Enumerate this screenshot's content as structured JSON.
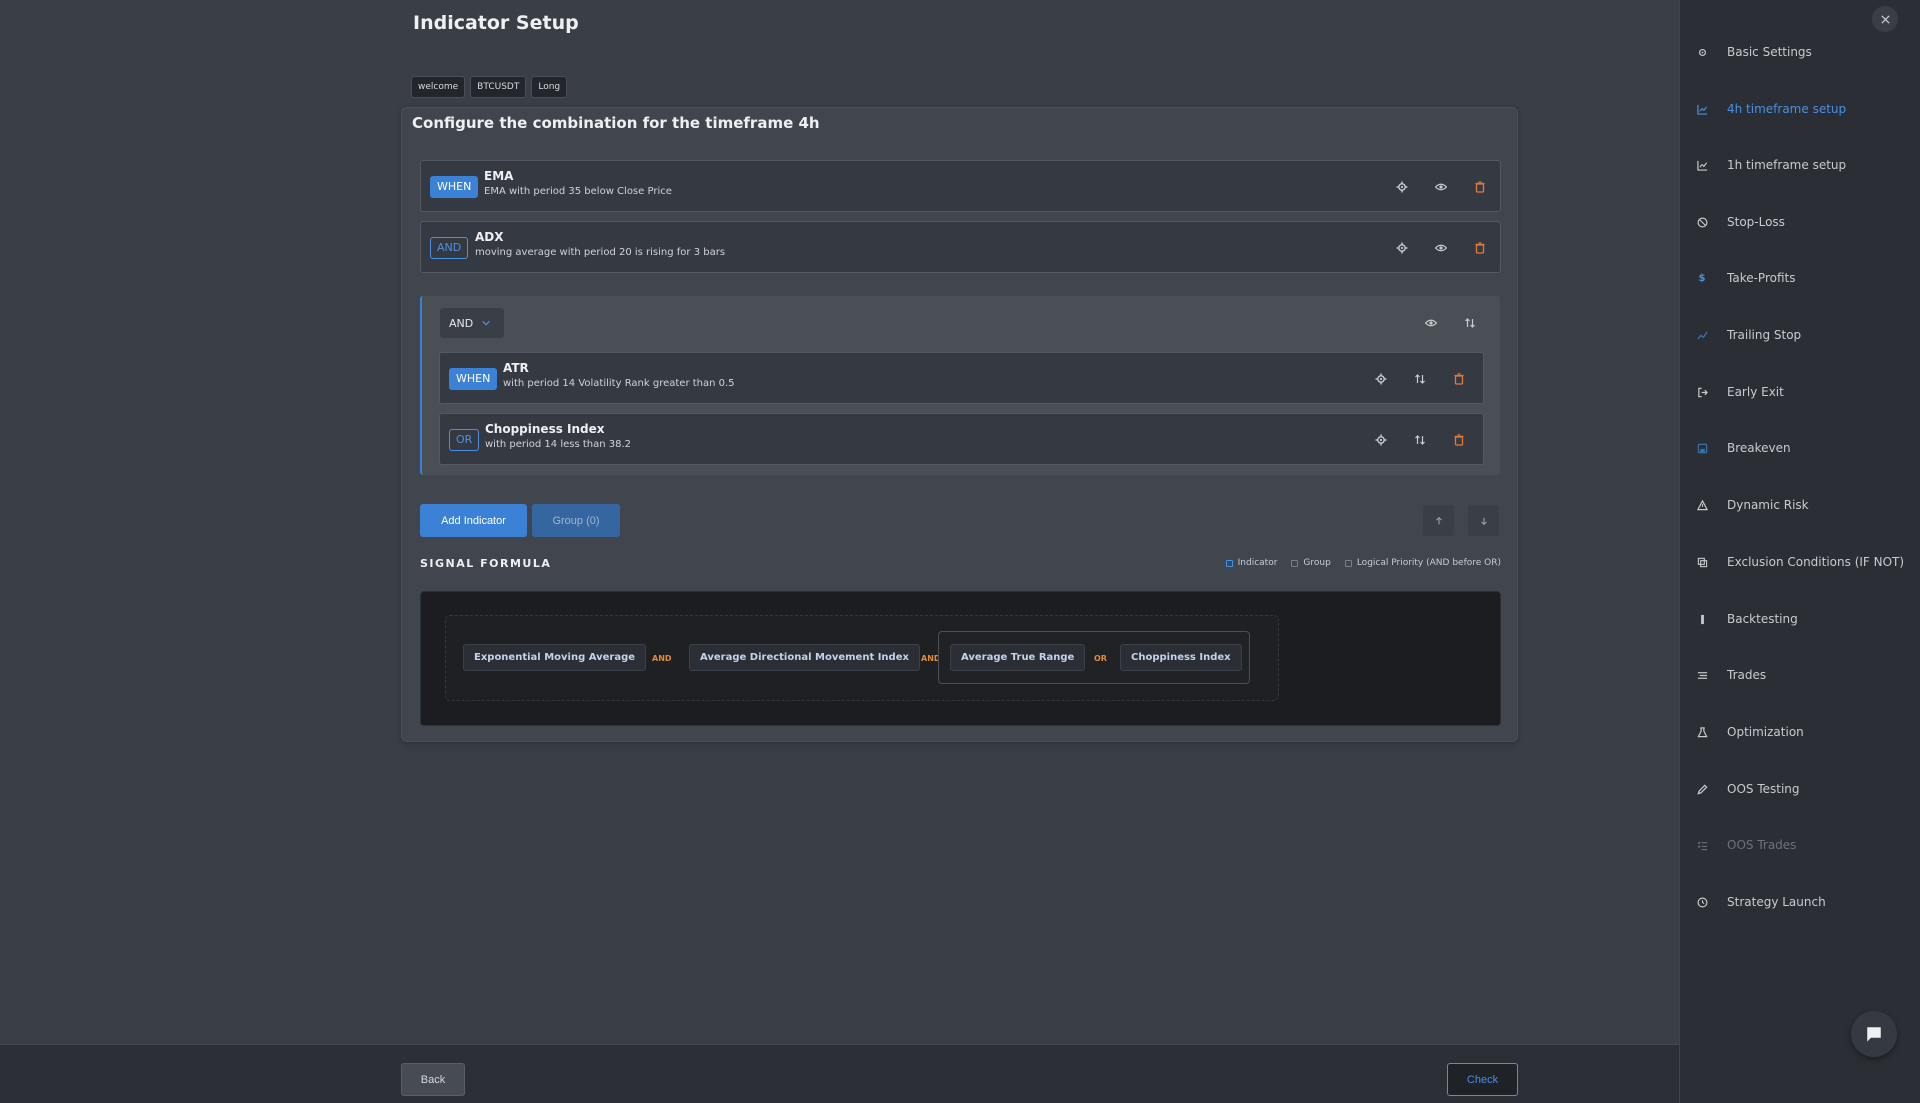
{
  "page": {
    "title": "Indicator Setup"
  },
  "tags": [
    "welcome",
    "BTCUSDT",
    "Long"
  ],
  "card": {
    "title": "Configure the combination for the timeframe 4h"
  },
  "conditions": [
    {
      "op": "WHEN",
      "name": "EMA",
      "desc": "EMA with period 35 below Close Price"
    },
    {
      "op": "AND",
      "name": "ADX",
      "desc": "moving average with period 20 is rising for 3 bars"
    }
  ],
  "group": {
    "operator": "AND",
    "conditions": [
      {
        "op": "WHEN",
        "name": "ATR",
        "desc": "with period 14 Volatility Rank greater than 0.5"
      },
      {
        "op": "OR",
        "name": "Choppiness Index",
        "desc": "with period 14 less than 38.2"
      }
    ]
  },
  "buttons": {
    "add_indicator": "Add Indicator",
    "group": "Group (0)",
    "back": "Back",
    "check": "Check"
  },
  "formula": {
    "title": "SIGNAL FORMULA",
    "legend": [
      "Indicator",
      "Group",
      "Logical Priority (AND before OR)"
    ],
    "chips": [
      "Exponential Moving Average",
      "Average Directional Movement Index",
      "Average True Range",
      "Choppiness Index"
    ],
    "ops": [
      "AND",
      "AND",
      "OR"
    ]
  },
  "sidebar": {
    "items": [
      {
        "label": "Basic Settings",
        "icon": "gear-icon",
        "state": "normal"
      },
      {
        "label": "4h timeframe setup",
        "icon": "chart-icon",
        "state": "active"
      },
      {
        "label": "1h timeframe setup",
        "icon": "chart-icon",
        "state": "normal"
      },
      {
        "label": "Stop-Loss",
        "icon": "stop-icon",
        "state": "normal"
      },
      {
        "label": "Take-Profits",
        "icon": "dollar-icon",
        "state": "normal"
      },
      {
        "label": "Trailing Stop",
        "icon": "trend-icon",
        "state": "normal"
      },
      {
        "label": "Early Exit",
        "icon": "exit-icon",
        "state": "normal"
      },
      {
        "label": "Breakeven",
        "icon": "save-icon",
        "state": "normal"
      },
      {
        "label": "Dynamic Risk",
        "icon": "warning-icon",
        "state": "normal"
      },
      {
        "label": "Exclusion Conditions (IF NOT)",
        "icon": "copy-icon",
        "state": "normal"
      },
      {
        "label": "Backtesting",
        "icon": "bar-icon",
        "state": "normal"
      },
      {
        "label": "Trades",
        "icon": "list-icon",
        "state": "normal"
      },
      {
        "label": "Optimization",
        "icon": "flask-icon",
        "state": "normal"
      },
      {
        "label": "OOS Testing",
        "icon": "pencil-icon",
        "state": "normal"
      },
      {
        "label": "OOS Trades",
        "icon": "checklist-icon",
        "state": "muted"
      },
      {
        "label": "Strategy Launch",
        "icon": "clock-icon",
        "state": "normal"
      }
    ]
  },
  "colors": {
    "accent": "#3b82d6",
    "danger": "#e07a3c",
    "operator": "#e08a3c"
  }
}
